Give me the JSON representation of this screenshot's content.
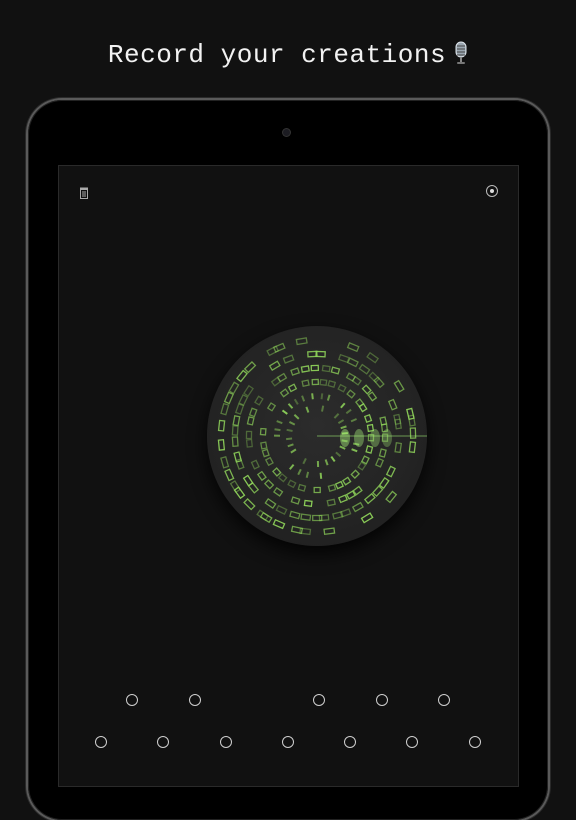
{
  "headline": {
    "text": "Record your creations",
    "icon": "microphone-icon"
  },
  "toolbar": {
    "left_icon": "trash-icon",
    "right_icon": "record-icon"
  },
  "visualizer": {
    "accent_color": "#8fd45a",
    "background_color": "#262626"
  },
  "colors": {
    "background": "#111111",
    "bezel": "#000000",
    "node_outline": "#cfcfcf"
  },
  "nodes": {
    "row1_count": 5,
    "row2_count": 7
  }
}
